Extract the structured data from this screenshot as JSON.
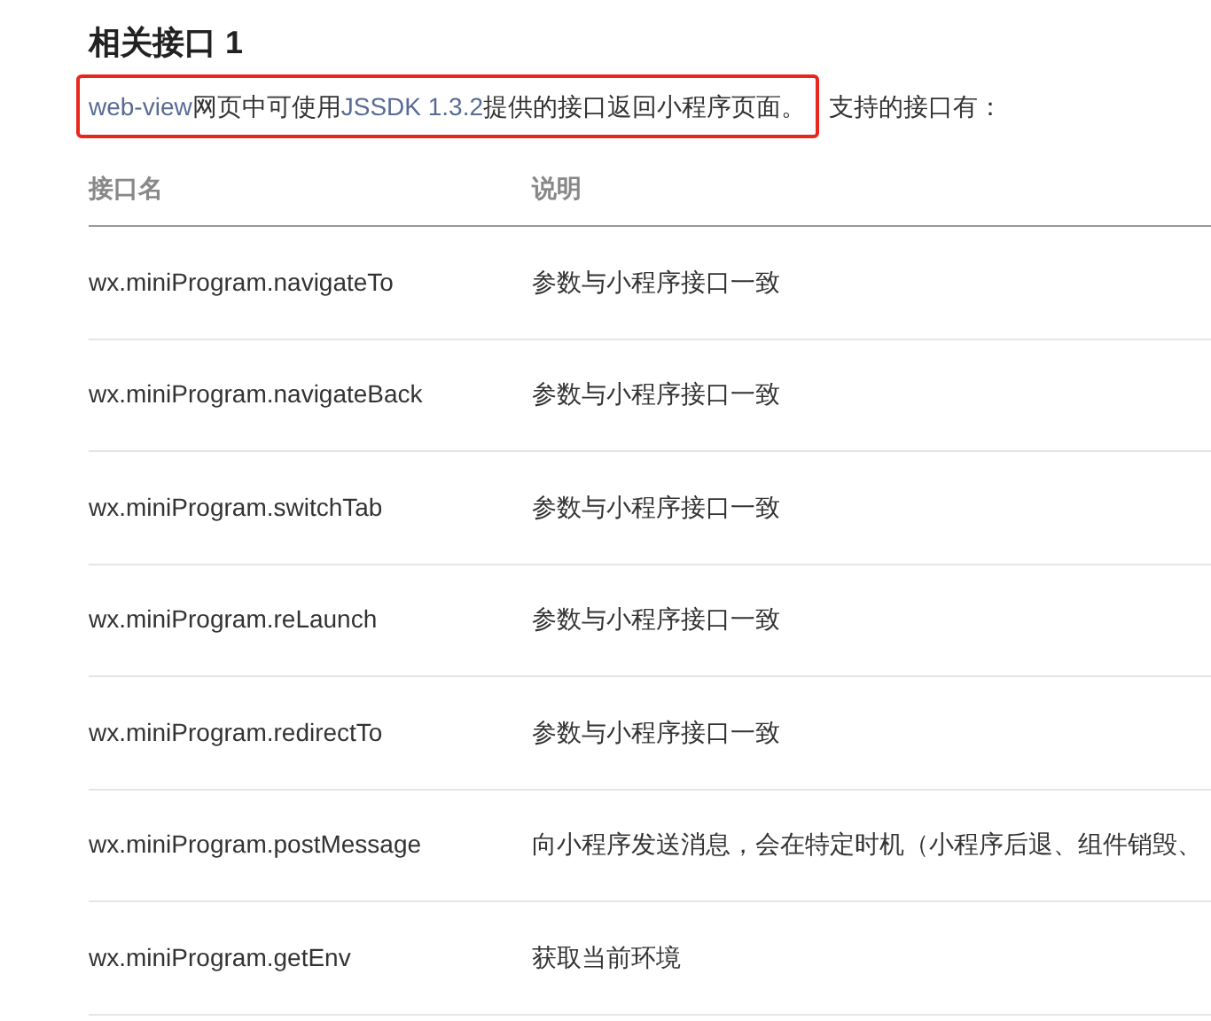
{
  "heading": "相关接口 1",
  "intro": {
    "highlighted": [
      {
        "kind": "link",
        "text": "web-view"
      },
      {
        "kind": "plain",
        "text": "网页中可使用"
      },
      {
        "kind": "link",
        "text": "JSSDK 1.3.2"
      },
      {
        "kind": "plain",
        "text": "提供的接口返回小程序页面。"
      }
    ],
    "rest": "支持的接口有："
  },
  "table": {
    "columns": [
      "接口名",
      "说明"
    ],
    "rows": [
      [
        "wx.miniProgram.navigateTo",
        "参数与小程序接口一致"
      ],
      [
        "wx.miniProgram.navigateBack",
        "参数与小程序接口一致"
      ],
      [
        "wx.miniProgram.switchTab",
        "参数与小程序接口一致"
      ],
      [
        "wx.miniProgram.reLaunch",
        "参数与小程序接口一致"
      ],
      [
        "wx.miniProgram.redirectTo",
        "参数与小程序接口一致"
      ],
      [
        "wx.miniProgram.postMessage",
        "向小程序发送消息，会在特定时机（小程序后退、组件销毁、"
      ],
      [
        "wx.miniProgram.getEnv",
        "获取当前环境"
      ]
    ]
  }
}
